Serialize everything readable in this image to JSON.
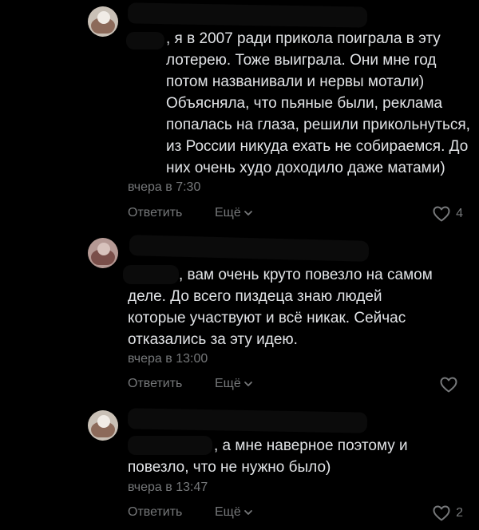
{
  "comments": [
    {
      "text": ", я в 2007 ради прикола поиграла в эту\nлотерею. Тоже выиграла. Они мне год\nпотом названивали и нервы мотали)\nОбъясняла, что пьяные были, реклама\nпопалась на глаза, решили прикольнуться,\nиз России никуда ехать не собираемся. До\nних очень худо доходило даже матами)",
      "time": "вчера в 7:30",
      "reply_label": "Ответить",
      "more_label": "Ещё",
      "likes": "4"
    },
    {
      "text": ", вам очень круто повезло на самом\nделе. До всего пиздеца знаю людей\nкоторые участвуют и всё никак. Сейчас\nотказались за эту идею.",
      "time": "вчера в 13:00",
      "reply_label": "Ответить",
      "more_label": "Ещё",
      "likes": ""
    },
    {
      "text": ", а мне наверное поэтому и\nповезло, что не нужно было)",
      "time": "вчера в 13:47",
      "reply_label": "Ответить",
      "more_label": "Ещё",
      "likes": "2"
    }
  ],
  "colors": {
    "background": "#000000",
    "text": "#e1e3e6",
    "secondary": "#76787a"
  },
  "icons": {
    "like": "heart-icon",
    "more": "chevron-down-icon"
  }
}
